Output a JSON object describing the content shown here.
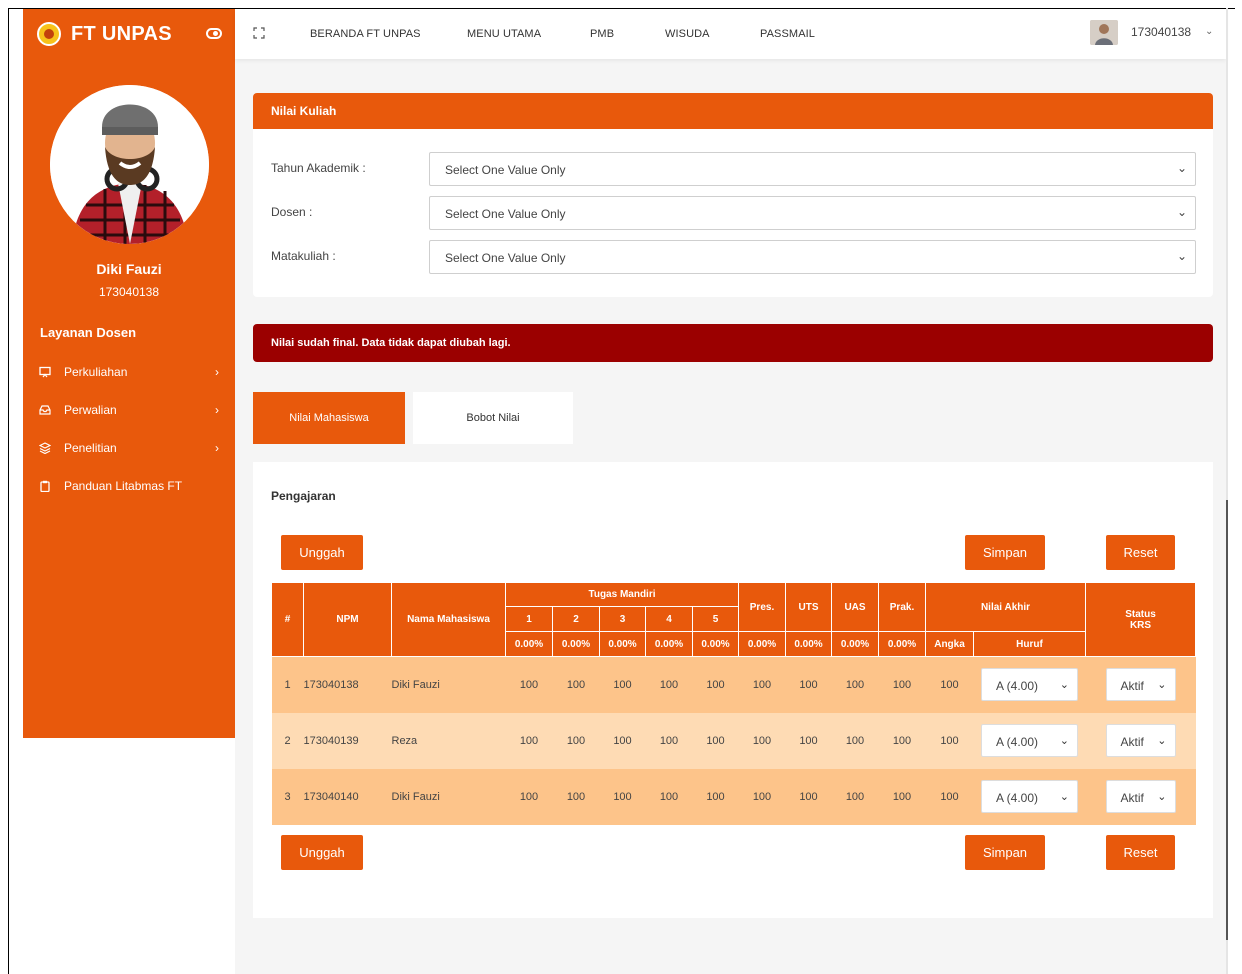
{
  "brand": {
    "title": "FT UNPAS"
  },
  "profile": {
    "name": "Diki Fauzi",
    "id": "173040138"
  },
  "sidebar": {
    "section_title": "Layanan Dosen",
    "items": [
      {
        "label": "Perkuliahan",
        "icon": "presentation-icon",
        "has_children": true
      },
      {
        "label": "Perwalian",
        "icon": "inbox-icon",
        "has_children": true
      },
      {
        "label": "Penelitian",
        "icon": "layers-icon",
        "has_children": true
      },
      {
        "label": "Panduan Litabmas FT",
        "icon": "clipboard-icon",
        "has_children": false
      }
    ]
  },
  "topbar": {
    "nav": [
      "BERANDA FT UNPAS",
      "MENU UTAMA",
      "PMB",
      "WISUDA",
      "PASSMAIL"
    ],
    "user": "173040138"
  },
  "filter_card": {
    "title": "Nilai Kuliah",
    "fields": [
      {
        "label": "Tahun Akademik :",
        "value": "Select One Value Only"
      },
      {
        "label": "Dosen :",
        "value": "Select One Value Only"
      },
      {
        "label": "Matakuliah :",
        "value": "Select One Value Only"
      }
    ]
  },
  "alert": {
    "text": "Nilai sudah final. Data tidak dapat diubah lagi."
  },
  "tabs": {
    "active": "Nilai Mahasiswa",
    "inactive": "Bobot Nilai"
  },
  "grades": {
    "section_title": "Pengajaran",
    "buttons": {
      "upload": "Unggah",
      "save": "Simpan",
      "reset": "Reset"
    },
    "headers": {
      "no": "#",
      "npm": "NPM",
      "name": "Nama Mahasiswa",
      "tugas": "Tugas Mandiri",
      "tugas_cols": [
        "1",
        "2",
        "3",
        "4",
        "5"
      ],
      "pres": "Pres.",
      "uts": "UTS",
      "uas": "UAS",
      "prak": "Prak.",
      "nilai_akhir": "Nilai Akhir",
      "angka": "Angka",
      "huruf": "Huruf",
      "status_krs": "Status KRS"
    },
    "weights": [
      "0.00%",
      "0.00%",
      "0.00%",
      "0.00%",
      "0.00%",
      "0.00%",
      "0.00%",
      "0.00%",
      "0.00%"
    ],
    "rows": [
      {
        "no": "1",
        "npm": "173040138",
        "name": "Diki Fauzi",
        "scores": [
          "100",
          "100",
          "100",
          "100",
          "100",
          "100",
          "100",
          "100",
          "100"
        ],
        "angka": "100",
        "huruf": "A (4.00)",
        "status": "Aktif"
      },
      {
        "no": "2",
        "npm": "173040139",
        "name": "Reza",
        "scores": [
          "100",
          "100",
          "100",
          "100",
          "100",
          "100",
          "100",
          "100",
          "100"
        ],
        "angka": "100",
        "huruf": "A (4.00)",
        "status": "Aktif"
      },
      {
        "no": "3",
        "npm": "173040140",
        "name": "Diki Fauzi",
        "scores": [
          "100",
          "100",
          "100",
          "100",
          "100",
          "100",
          "100",
          "100",
          "100"
        ],
        "angka": "100",
        "huruf": "A (4.00)",
        "status": "Aktif"
      }
    ]
  },
  "colors": {
    "accent": "#e8590c",
    "alert": "#9b0000",
    "row_odd": "#fdc48a",
    "row_even": "#fedbb4"
  }
}
